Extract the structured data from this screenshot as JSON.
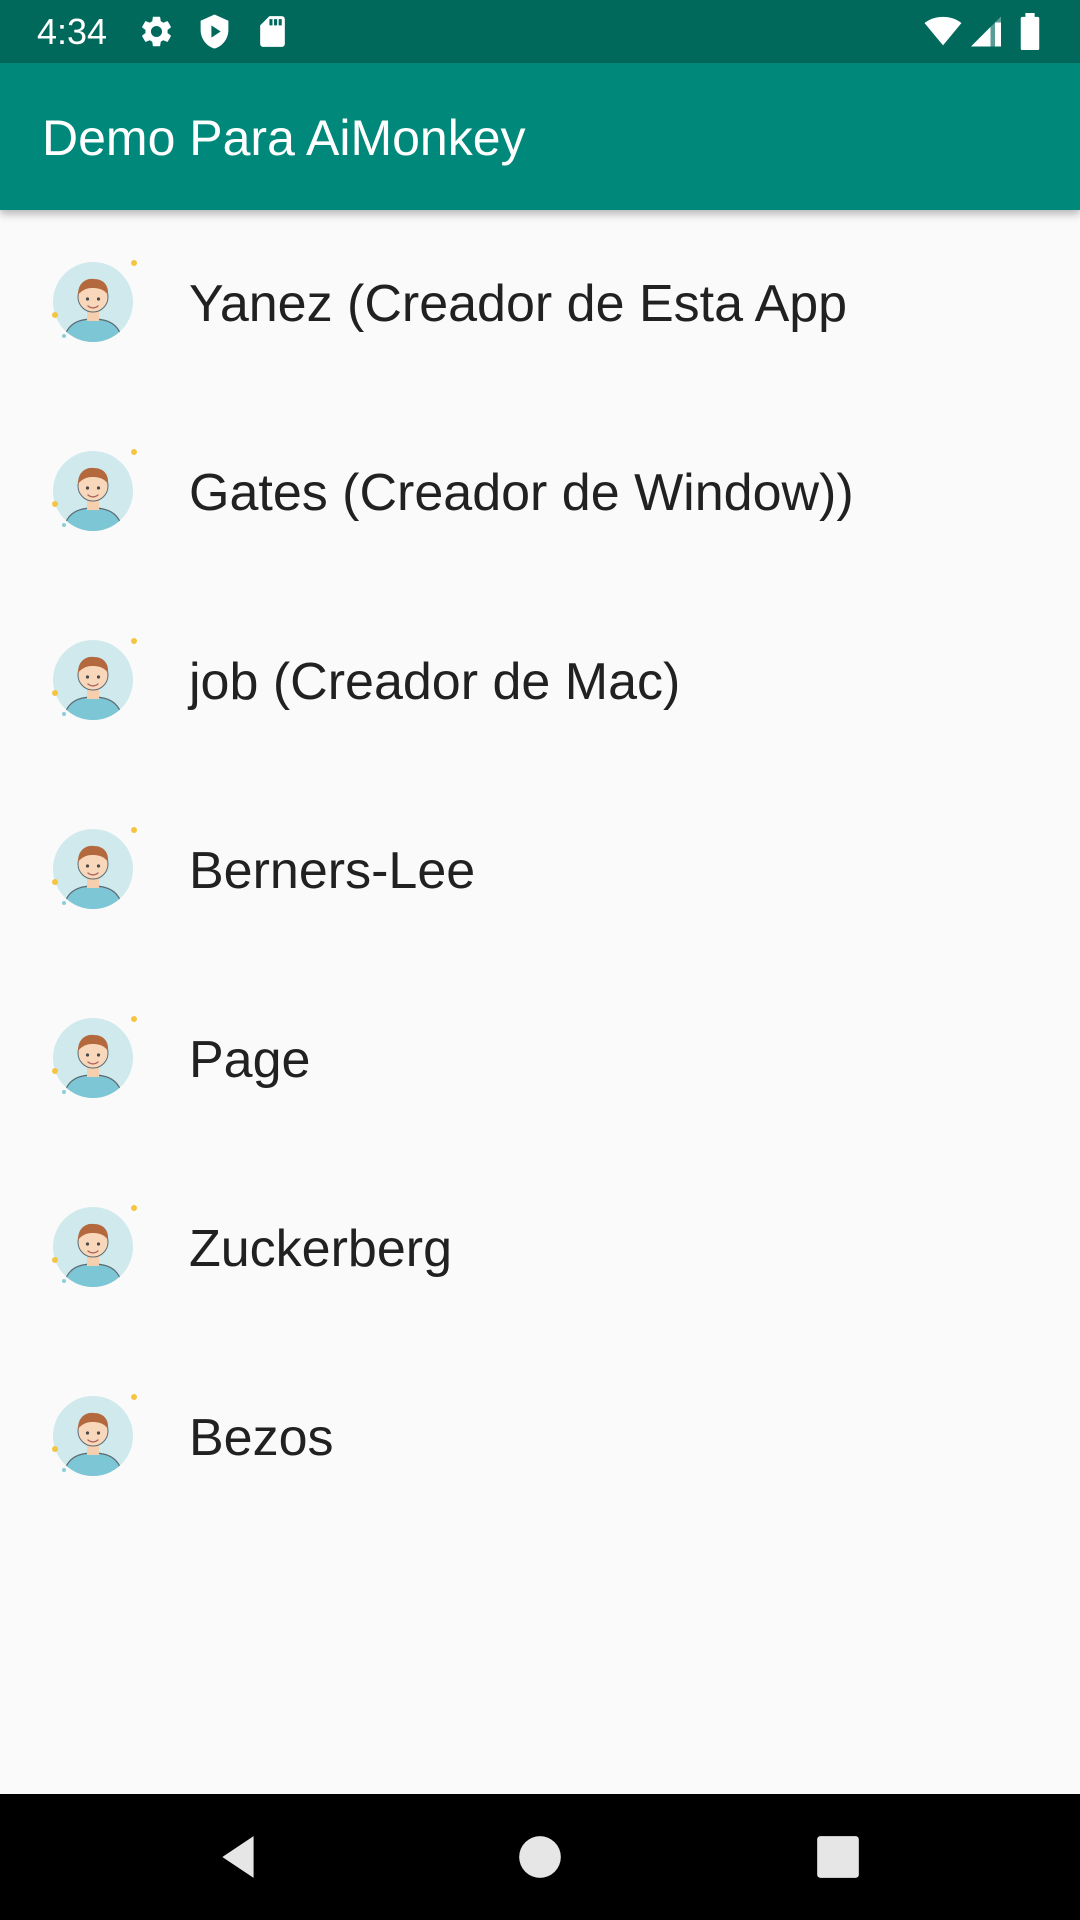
{
  "status_bar": {
    "time": "4:34",
    "icons_left": [
      "gear-icon",
      "shield-icon",
      "sd-card-icon"
    ],
    "icons_right": [
      "wifi-icon",
      "cell-signal-icon",
      "battery-icon"
    ]
  },
  "app_bar": {
    "title": "Demo Para AiMonkey",
    "color": "#00897b",
    "status_color": "#00695c"
  },
  "contacts": [
    {
      "name": "Yanez (Creador de Esta App",
      "icon": "avatar-icon"
    },
    {
      "name": "Gates (Creador de Window))",
      "icon": "avatar-icon"
    },
    {
      "name": "job (Creador de Mac)",
      "icon": "avatar-icon"
    },
    {
      "name": "Berners-Lee",
      "icon": "avatar-icon"
    },
    {
      "name": "Page",
      "icon": "avatar-icon"
    },
    {
      "name": "Zuckerberg",
      "icon": "avatar-icon"
    },
    {
      "name": "Bezos",
      "icon": "avatar-icon"
    }
  ],
  "nav_bar": {
    "buttons": [
      "back-icon",
      "home-icon",
      "recents-icon"
    ]
  }
}
